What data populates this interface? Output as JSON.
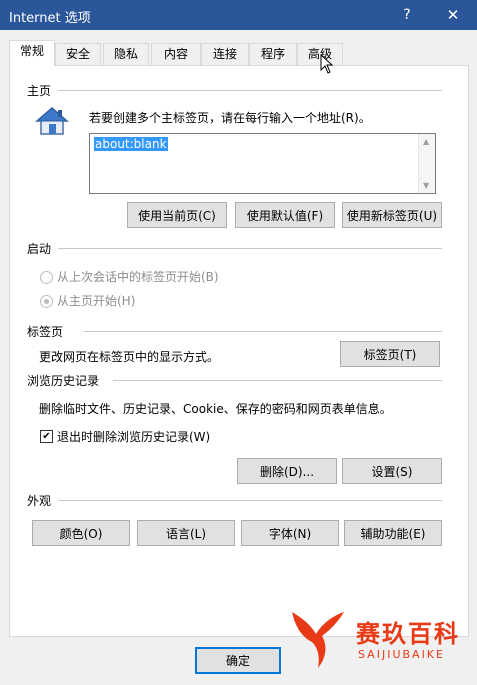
{
  "window": {
    "title": "Internet 选项",
    "help_icon": "?",
    "close_icon": "✕"
  },
  "tabs": [
    {
      "label": "常规",
      "active": true
    },
    {
      "label": "安全"
    },
    {
      "label": "隐私"
    },
    {
      "label": "内容"
    },
    {
      "label": "连接"
    },
    {
      "label": "程序"
    },
    {
      "label": "高级"
    }
  ],
  "homepage": {
    "group_title": "主页",
    "icon": "house-icon",
    "instruction": "若要创建多个主标签页，请在每行输入一个地址(R)。",
    "url_value": "about:blank",
    "buttons": {
      "use_current": "使用当前页(C)",
      "use_default": "使用默认值(F)",
      "use_new_tab": "使用新标签页(U)"
    }
  },
  "startup": {
    "group_title": "启动",
    "options": [
      {
        "label": "从上次会话中的标签页开始(B)",
        "selected": false,
        "enabled": false
      },
      {
        "label": "从主页开始(H)",
        "selected": true,
        "enabled": false
      }
    ]
  },
  "tabs_group": {
    "group_title": "标签页",
    "description": "更改网页在标签页中的显示方式。",
    "button": "标签页(T)"
  },
  "history": {
    "group_title": "浏览历史记录",
    "description": "删除临时文件、历史记录、Cookie、保存的密码和网页表单信息。",
    "checkbox_label": "退出时删除浏览历史记录(W)",
    "checkbox_checked": true,
    "delete_button": "删除(D)...",
    "settings_button": "设置(S)"
  },
  "appearance": {
    "group_title": "外观",
    "buttons": {
      "colors": "颜色(O)",
      "languages": "语言(L)",
      "fonts": "字体(N)",
      "accessibility": "辅助功能(E)"
    }
  },
  "footer": {
    "ok_button": "确定"
  },
  "watermark": {
    "text_cn": "赛玖百科",
    "text_en": "SAIJIUBAIKE"
  },
  "colors": {
    "titlebar": "#2b579a",
    "dialog_bg": "#f0f0f0",
    "selection": "#3399ff",
    "watermark": "#e83a17"
  }
}
